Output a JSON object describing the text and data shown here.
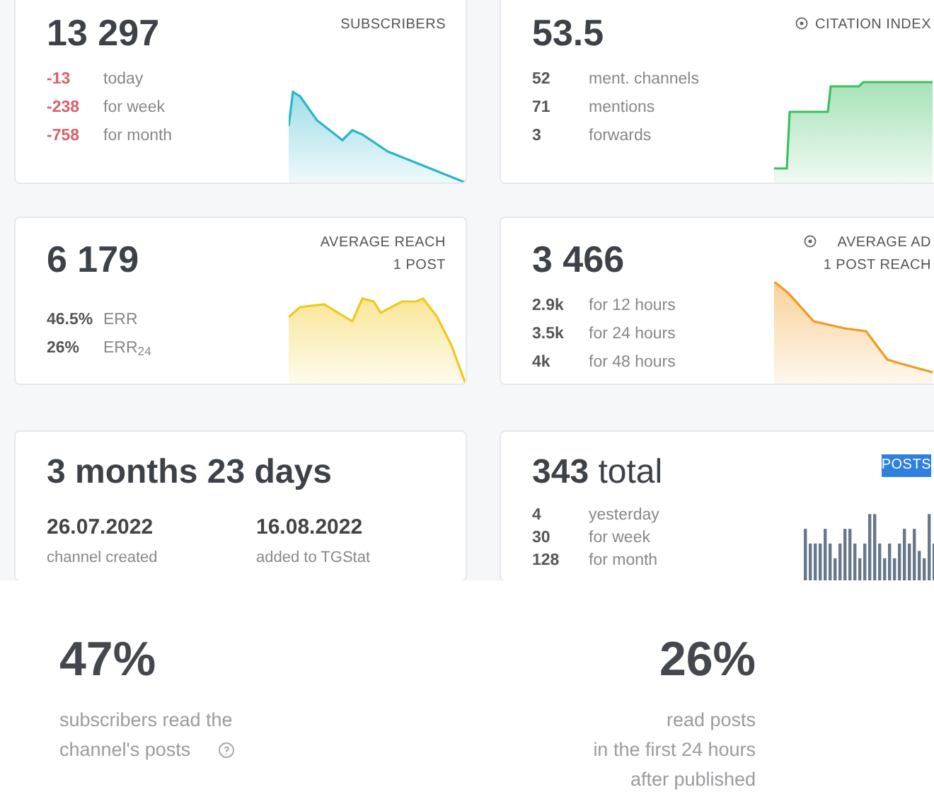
{
  "cards": [
    {
      "kind": "subscribers",
      "value": "13 297",
      "label": [
        "SUBSCRIBERS"
      ],
      "info_icon": false,
      "color": "#2bb5c9",
      "stats": [
        {
          "number": "-13",
          "text": "today",
          "negative": true
        },
        {
          "number": "-238",
          "text": "for week",
          "negative": true
        },
        {
          "number": "-758",
          "text": "for month",
          "negative": true
        }
      ]
    },
    {
      "kind": "citation",
      "value": "53.5",
      "label": [
        "CITATION INDEX"
      ],
      "info_icon": true,
      "color": "#3cbf62",
      "stats": [
        {
          "number": "52",
          "text": "ment. channels",
          "negative": false
        },
        {
          "number": "71",
          "text": "mentions",
          "negative": false
        },
        {
          "number": "3",
          "text": "forwards",
          "negative": false
        }
      ]
    },
    {
      "kind": "reach",
      "value": "6 179",
      "label": [
        "AVERAGE REACH",
        "1 POST"
      ],
      "info_icon": false,
      "color": "#f2c81a",
      "stats": [
        {
          "number": "46.5%",
          "text": "ERR",
          "negative": false
        },
        {
          "number": "26%",
          "text": "ERR$_{24}$",
          "negative": false
        }
      ]
    },
    {
      "kind": "ad_reach",
      "value": "3 466",
      "label": [
        "AVERAGE AD",
        "1 POST REACH"
      ],
      "info_icon": true,
      "color": "#f29a1f",
      "stats": [
        {
          "number": "2.9k",
          "text": "for 12 hours",
          "negative": false
        },
        {
          "number": "3.5k",
          "text": "for 24 hours",
          "negative": false
        },
        {
          "number": "4k",
          "text": "for 48 hours",
          "negative": false
        }
      ]
    },
    {
      "kind": "age",
      "value": "3 months 23 days",
      "dates": [
        {
          "date": "26.07.2022",
          "caption": "channel created"
        },
        {
          "date": "16.08.2022",
          "caption": "added to TGStat"
        }
      ]
    },
    {
      "kind": "posts",
      "value": "**343** total",
      "label": [
        "POSTS"
      ],
      "label_highlighted": true,
      "info_icon": false,
      "color": "#66788a",
      "stats": [
        {
          "number": "4",
          "text": "yesterday",
          "negative": false
        },
        {
          "number": "30",
          "text": "for week",
          "negative": false
        },
        {
          "number": "128",
          "text": "for month",
          "negative": false
        }
      ]
    }
  ],
  "summary": [
    {
      "value": "47%",
      "lines": [
        "subscribers read the",
        "channel's posts"
      ],
      "help_icon": true
    },
    {
      "value": "26%",
      "lines": [
        "read posts",
        "in the first 24 hours",
        "after published"
      ],
      "help_icon": false
    }
  ]
}
